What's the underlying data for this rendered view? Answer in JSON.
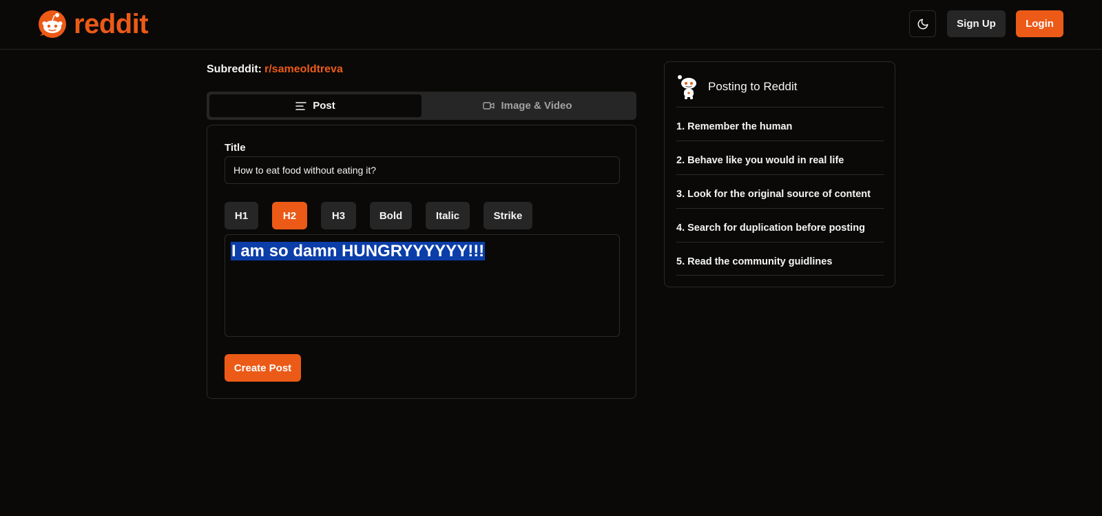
{
  "brand": {
    "name": "reddit",
    "accent": "#ec5a17"
  },
  "header": {
    "theme_toggle_icon": "moon-icon",
    "signup_label": "Sign Up",
    "login_label": "Login"
  },
  "subreddit": {
    "label": "Subreddit:",
    "name": "r/sameoldtreva"
  },
  "tabs": [
    {
      "label": "Post",
      "icon": "text-lines-icon",
      "active": true
    },
    {
      "label": "Image & Video",
      "icon": "video-camera-icon",
      "active": false
    }
  ],
  "form": {
    "title_label": "Title",
    "title_value": "How to eat food without eating it?",
    "format_buttons": [
      {
        "label": "H1",
        "active": false
      },
      {
        "label": "H2",
        "active": true
      },
      {
        "label": "H3",
        "active": false
      },
      {
        "label": "Bold",
        "active": false
      },
      {
        "label": "Italic",
        "active": false
      },
      {
        "label": "Strike",
        "active": false
      }
    ],
    "editor_content": "I am so damn HUNGRYYYYYY!!!",
    "submit_label": "Create Post"
  },
  "rules": {
    "title": "Posting to Reddit",
    "items": [
      "1. Remember the human",
      "2. Behave like you would in real life",
      "3. Look for the original source of content",
      "4. Search for duplication before posting",
      "5. Read the community guidlines"
    ]
  },
  "colors": {
    "background": "#0a0908",
    "border": "#2b2b2b",
    "button_muted": "#262626",
    "selection": "#0b3ea9"
  }
}
